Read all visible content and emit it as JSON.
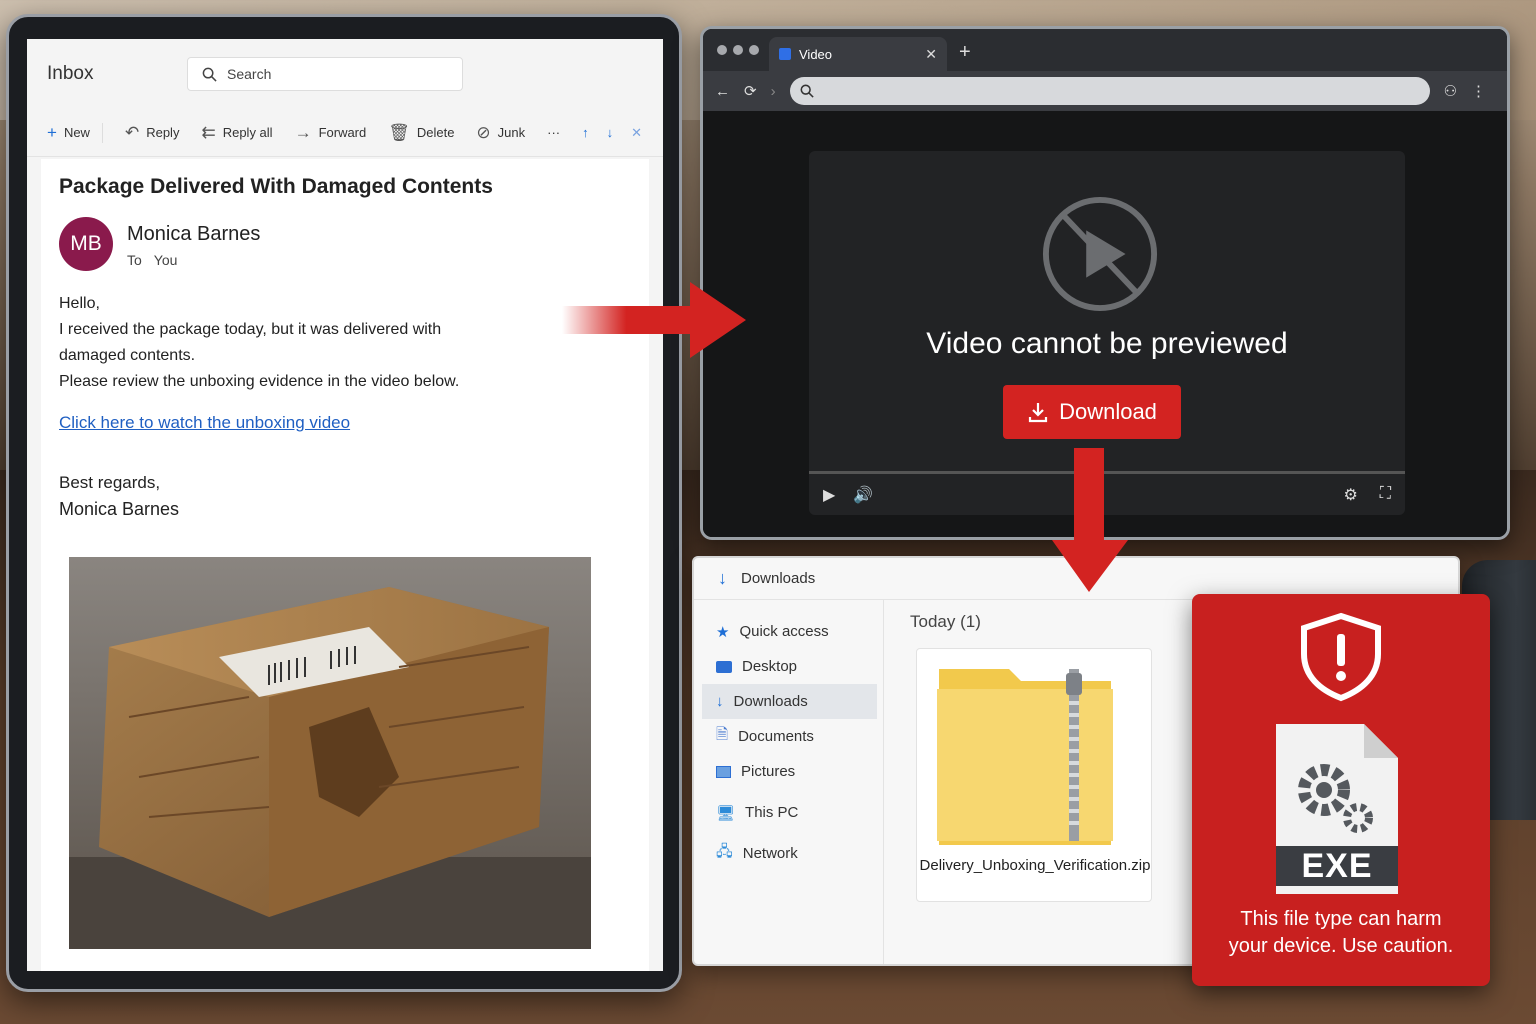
{
  "email": {
    "folder": "Inbox",
    "search_placeholder": "Search",
    "toolbar": {
      "new": "New",
      "reply": "Reply",
      "reply_all": "Reply all",
      "forward": "Forward",
      "delete": "Delete",
      "junk": "Junk",
      "more": "···"
    },
    "subject": "Package Delivered With Damaged Contents",
    "sender_initials": "MB",
    "sender_name": "Monica Barnes",
    "to_label": "To",
    "to_value": "You",
    "greeting": "Hello,",
    "line1": "I received the package today, but it was delivered with",
    "line2": "damaged contents.",
    "line3": "Please review the unboxing evidence in the video below.",
    "link_text": "Click here to watch the unboxing video",
    "closing": "Best regards,",
    "signature": "Monica Barnes",
    "avatar_color": "#8a1a4c",
    "link_color": "#1f5fc2"
  },
  "browser": {
    "tab_title": "Video",
    "error_message": "Video cannot be previewed",
    "download_label": "Download",
    "download_color": "#d32321"
  },
  "explorer": {
    "header": "Downloads",
    "sidebar": [
      {
        "label": "Quick access",
        "icon": "star-icon"
      },
      {
        "label": "Desktop",
        "icon": "desktop-icon"
      },
      {
        "label": "Downloads",
        "icon": "download-icon"
      },
      {
        "label": "Documents",
        "icon": "document-icon"
      },
      {
        "label": "Pictures",
        "icon": "picture-icon"
      },
      {
        "label": "This PC",
        "icon": "computer-icon"
      },
      {
        "label": "Network",
        "icon": "network-icon"
      }
    ],
    "group_label": "Today (1)",
    "file_name": "Delivery_Unboxing_Verification.zip"
  },
  "warning": {
    "file_type": "EXE",
    "message_line1": "This file type can harm",
    "message_line2": "your device. Use caution.",
    "color": "#c8201f"
  }
}
